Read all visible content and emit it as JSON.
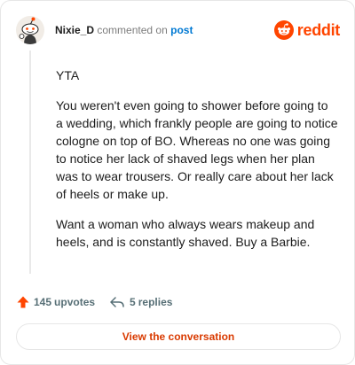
{
  "comment": {
    "username": "Nixie_D",
    "action_text": "commented on",
    "post_link_text": "post",
    "paragraphs": [
      "YTA",
      "You weren't even going to shower before going to a wedding, which frankly people are going to notice cologne on top of BO. Whereas no one was going to notice her lack of shaved legs when her plan was to wear trousers. Or really care about her lack of heels or make up.",
      "Want a woman who always wears makeup and heels, and is constantly shaved. Buy a Barbie."
    ],
    "upvotes_count": "145",
    "upvotes_label": "upvotes",
    "replies_count": "5",
    "replies_label": "replies"
  },
  "brand": {
    "wordmark": "reddit",
    "icon": "reddit-snoo-logo",
    "color": "#ff4500"
  },
  "avatar": {
    "icon": "snoo-avatar"
  },
  "icons": {
    "upvote": "upvote-arrow-icon",
    "reply": "reply-arrow-icon"
  },
  "footer": {
    "view_button_label": "View the conversation"
  },
  "colors": {
    "accent": "#ff4500",
    "link": "#0079d3",
    "button_text": "#d93a00",
    "muted": "#576f76"
  }
}
